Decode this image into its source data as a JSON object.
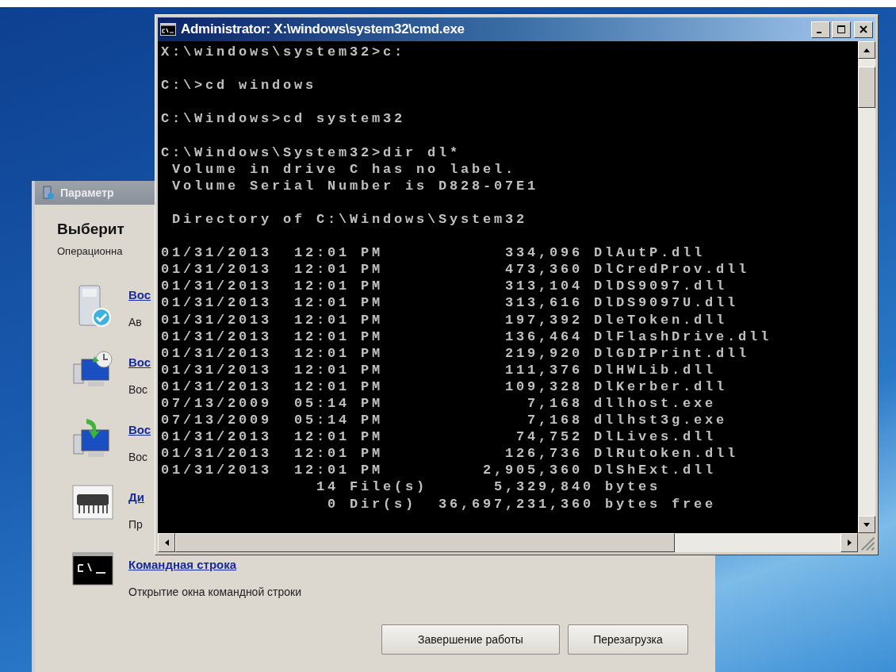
{
  "back_window": {
    "title": "Параметр",
    "heading": "Выберит",
    "subtitle": "Операционна",
    "options": [
      {
        "kind": "drive",
        "link": "Вос",
        "description": "Ав"
      },
      {
        "kind": "clock",
        "link": "Вос",
        "description": "Вос"
      },
      {
        "kind": "restore",
        "link": "Вос",
        "description": "Вос"
      },
      {
        "kind": "memory",
        "link": "Ди",
        "description": "Пр"
      },
      {
        "kind": "console",
        "link": "Командная строка",
        "description": "Открытие окна командной строки"
      }
    ],
    "buttons": [
      "Завершение работы",
      "Перезагрузка"
    ]
  },
  "console_window": {
    "title": "Administrator: X:\\windows\\system32\\cmd.exe",
    "blocks": [
      [
        "X:\\windows\\system32>c:"
      ],
      [
        "C:\\>cd windows"
      ],
      [
        "C:\\Windows>cd system32"
      ],
      [
        "C:\\Windows\\System32>dir dl*",
        " Volume in drive C has no label.",
        " Volume Serial Number is D828-07E1"
      ],
      [
        " Directory of C:\\Windows\\System32"
      ],
      [
        "01/31/2013  12:01 PM           334,096 DlAutP.dll",
        "01/31/2013  12:01 PM           473,360 DlCredProv.dll",
        "01/31/2013  12:01 PM           313,104 DlDS9097.dll",
        "01/31/2013  12:01 PM           313,616 DlDS9097U.dll",
        "01/31/2013  12:01 PM           197,392 DleToken.dll",
        "01/31/2013  12:01 PM           136,464 DlFlashDrive.dll",
        "01/31/2013  12:01 PM           219,920 DlGDIPrint.dll",
        "01/31/2013  12:01 PM           111,376 DlHWLib.dll",
        "01/31/2013  12:01 PM           109,328 DlKerber.dll",
        "07/13/2009  05:14 PM             7,168 dllhost.exe",
        "07/13/2009  05:14 PM             7,168 dllhst3g.exe",
        "01/31/2013  12:01 PM            74,752 DlLives.dll",
        "01/31/2013  12:01 PM           126,736 DlRutoken.dll",
        "01/31/2013  12:01 PM         2,905,360 DlShExt.dll",
        "              14 File(s)      5,329,840 bytes",
        "               0 Dir(s)  36,697,231,360 bytes free"
      ]
    ]
  }
}
